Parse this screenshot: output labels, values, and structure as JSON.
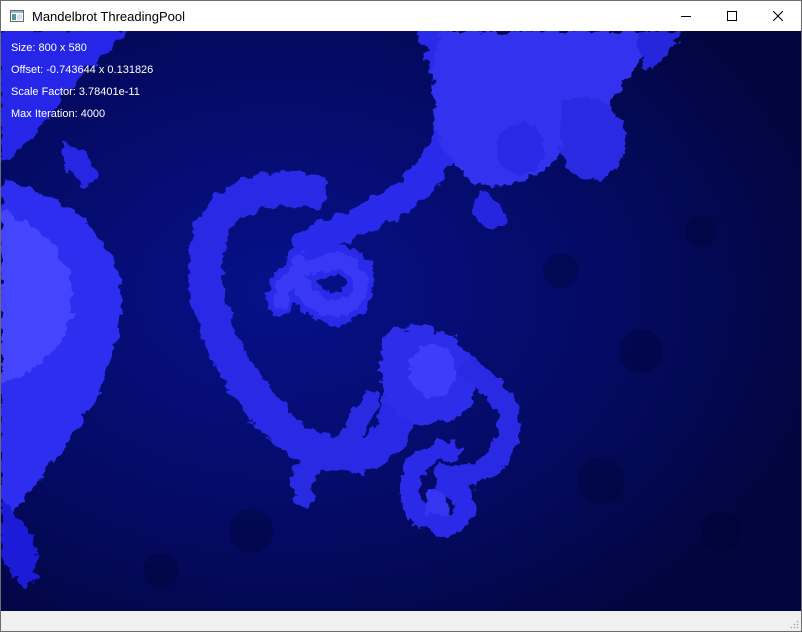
{
  "window": {
    "title": "Mandelbrot ThreadingPool",
    "icon": "application-window-icon"
  },
  "caption_buttons": {
    "minimize_icon": "minimize-icon",
    "maximize_icon": "maximize-icon",
    "close_icon": "close-icon"
  },
  "overlay": {
    "size": "Size: 800 x 580",
    "offset": "Offset: -0.743644 x 0.131826",
    "scale_factor": "Scale Factor: 3.78401e-11",
    "max_iteration": "Max Iteration: 4000"
  },
  "colors": {
    "background": "#020642",
    "fractal_dark": "#1a1acf",
    "fractal_light": "#3f3ff5",
    "fractal_highlight": "#5656ff",
    "text": "#ffffff"
  }
}
